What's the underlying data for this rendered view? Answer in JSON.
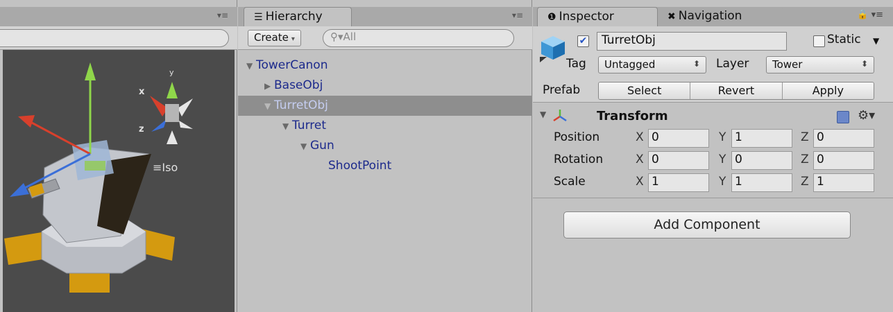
{
  "scene": {
    "menu_icon": "panel-menu-icon",
    "view_mode": "Iso",
    "gizmo_labels": {
      "x": "x",
      "y": "y",
      "z": "z"
    }
  },
  "hierarchy": {
    "tab_label": "Hierarchy",
    "create_label": "Create",
    "search_placeholder": "All",
    "items": [
      {
        "label": "TowerCanon",
        "expanded": true,
        "depth": 0,
        "selected": false
      },
      {
        "label": "BaseObj",
        "expanded": false,
        "depth": 1,
        "selected": false
      },
      {
        "label": "TurretObj",
        "expanded": true,
        "depth": 1,
        "selected": true
      },
      {
        "label": "Turret",
        "expanded": true,
        "depth": 2,
        "selected": false
      },
      {
        "label": "Gun",
        "expanded": true,
        "depth": 3,
        "selected": false
      },
      {
        "label": "ShootPoint",
        "expanded": null,
        "depth": 4,
        "selected": false
      }
    ]
  },
  "inspector": {
    "tab_label": "Inspector",
    "nav_tab_label": "Navigation",
    "object_name": "TurretObj",
    "active_checked": true,
    "static_label": "Static",
    "static_checked": false,
    "tag_label": "Tag",
    "tag_value": "Untagged",
    "layer_label": "Layer",
    "layer_value": "Tower",
    "prefab_label": "Prefab",
    "prefab_buttons": [
      "Select",
      "Revert",
      "Apply"
    ],
    "transform": {
      "title": "Transform",
      "rows": [
        {
          "label": "Position",
          "x": "0",
          "y": "1",
          "z": "0"
        },
        {
          "label": "Rotation",
          "x": "0",
          "y": "0",
          "z": "0"
        },
        {
          "label": "Scale",
          "x": "1",
          "y": "1",
          "z": "1"
        }
      ],
      "axis_labels": [
        "X",
        "Y",
        "Z"
      ]
    },
    "add_component_label": "Add Component"
  }
}
